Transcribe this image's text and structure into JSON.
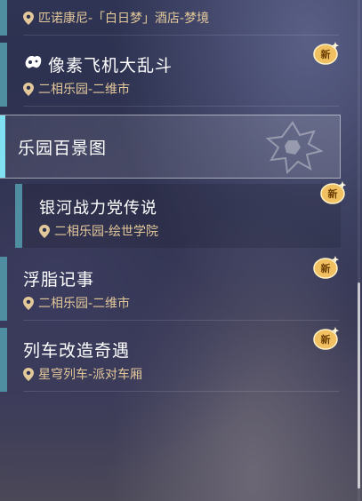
{
  "list": {
    "items": [
      {
        "title": "",
        "location": "匹诺康尼-「白日梦」酒店-梦境",
        "new": false
      },
      {
        "title": "像素飞机大乱斗",
        "location": "二相乐园-二维市",
        "new": true,
        "badge": "新"
      },
      {
        "title": "银河战力党传说",
        "location": "二相乐园-绘世学院",
        "new": true,
        "badge": "新"
      },
      {
        "title": "浮脂记事",
        "location": "二相乐园-二维市",
        "new": true,
        "badge": "新"
      },
      {
        "title": "列车改造奇遇",
        "location": "星穹列车-派对车厢",
        "new": true,
        "badge": "新"
      }
    ]
  },
  "section": {
    "title": "乐园百景图"
  },
  "colors": {
    "accent": "#4e8ea0",
    "section_bar": "#7fe0f2",
    "location_text": "#e3c89a",
    "badge": "#f1c060"
  },
  "icons": {
    "location": "map-pin-icon",
    "category": "controller-icon",
    "badge": "sparkle-new-badge-icon"
  }
}
